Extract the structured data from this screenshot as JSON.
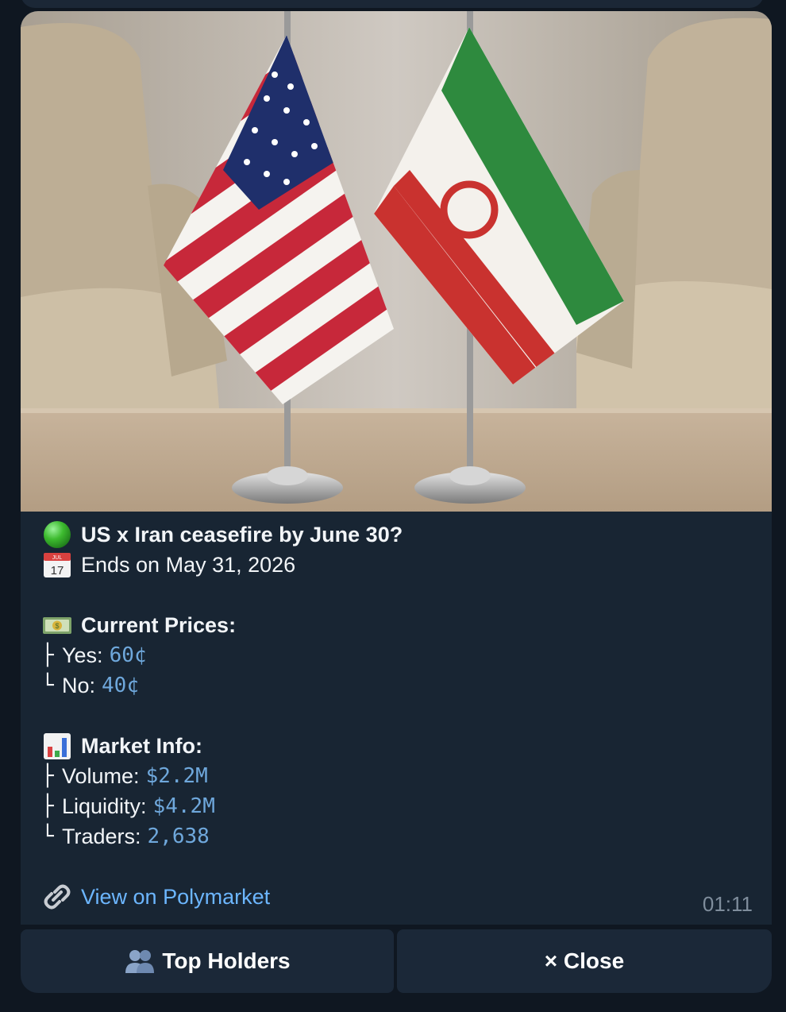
{
  "market": {
    "status_icon": "green-circle-icon",
    "title": "US x Iran ceasefire by June 30?",
    "calendar_icon": "calendar-icon",
    "calendar_month": "JUL",
    "calendar_day": "17",
    "ends": "Ends on May 31, 2026"
  },
  "prices": {
    "icon": "money-icon",
    "header": "Current Prices:",
    "yes_label": "Yes:",
    "yes_value": "60¢",
    "no_label": "No:",
    "no_value": "40¢"
  },
  "info": {
    "icon": "bar-chart-icon",
    "header": "Market Info:",
    "volume_label": "Volume:",
    "volume_value": "$2.2M",
    "liquidity_label": "Liquidity:",
    "liquidity_value": "$4.2M",
    "traders_label": "Traders:",
    "traders_value": "2,638"
  },
  "tree": {
    "branch": "├",
    "last": "└"
  },
  "link": {
    "icon": "link-icon",
    "text": "View on Polymarket"
  },
  "message_time": "01:11",
  "buttons": {
    "top_holders_icon": "people-icon",
    "top_holders": "Top Holders",
    "close": "× Close"
  },
  "colors": {
    "background": "#0f1721",
    "bubble": "#182533",
    "button": "#1b2838",
    "value_blue": "#6fa8dc",
    "link_blue": "#6cb6ff",
    "time_gray": "#7f8d9c"
  }
}
